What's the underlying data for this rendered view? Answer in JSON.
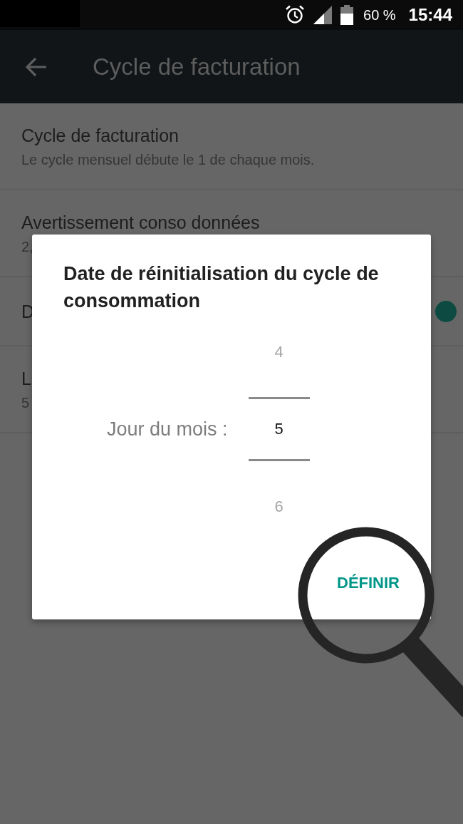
{
  "status_bar": {
    "battery_text": "60 %",
    "time": "15:44"
  },
  "app_bar": {
    "title": "Cycle de facturation"
  },
  "settings": [
    {
      "kind": "text",
      "title": "Cycle de facturation",
      "subtitle": "Le cycle mensuel débute le 1 de chaque mois."
    },
    {
      "kind": "text",
      "title": "Avertissement conso données",
      "subtitle": "2,"
    },
    {
      "kind": "switch",
      "title": "D",
      "on": true
    },
    {
      "kind": "text",
      "title": "L",
      "subtitle": "5"
    }
  ],
  "dialog": {
    "title": "Date de réinitialisation du cycle de consommation",
    "picker": {
      "label": "Jour du mois :",
      "values": [
        {
          "text": "4",
          "selected": false
        },
        {
          "text": "5",
          "selected": true
        },
        {
          "text": "6",
          "selected": false
        }
      ]
    },
    "buttons": [
      "DÉFINIR"
    ]
  }
}
